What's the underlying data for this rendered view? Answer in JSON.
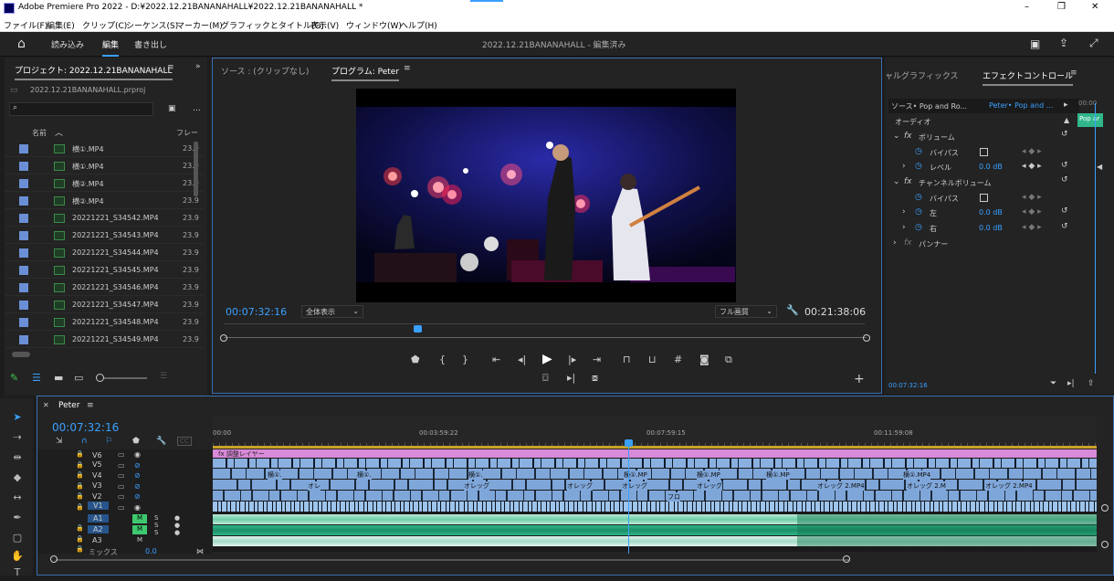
{
  "window": {
    "app": "Adobe Premiere Pro 2022",
    "path": "D:¥2022.12.21BANANAHALL¥2022.12.21BANANAHALL *",
    "controls": [
      "–",
      "❐",
      "✕"
    ]
  },
  "menu": [
    "ファイル(F)",
    "編集(E)",
    "クリップ(C)",
    "シーケンス(S)",
    "マーカー(M)",
    "グラフィックとタイトル(G)",
    "表示(V)",
    "ウィンドウ(W)",
    "ヘルプ(H)"
  ],
  "workspace": {
    "tabs": [
      "読み込み",
      "編集",
      "書き出し"
    ],
    "active": "編集",
    "title": "2022.12.21BANANAHALL - 編集済み"
  },
  "project": {
    "tab": "プロジェクト: 2022.12.21BANANAHALL",
    "file": "2022.12.21BANANAHALL.prproj",
    "col_name": "名前",
    "col_fps": "フレー",
    "items": [
      {
        "name": "横①.MP4",
        "fps": "23.9"
      },
      {
        "name": "横①.MP4",
        "fps": "23.9"
      },
      {
        "name": "横②.MP4",
        "fps": "23.9"
      },
      {
        "name": "横②.MP4",
        "fps": "23.9"
      },
      {
        "name": "20221221_S34542.MP4",
        "fps": "23.9"
      },
      {
        "name": "20221221_S34543.MP4",
        "fps": "23.9"
      },
      {
        "name": "20221221_S34544.MP4",
        "fps": "23.9"
      },
      {
        "name": "20221221_S34545.MP4",
        "fps": "23.9"
      },
      {
        "name": "20221221_S34546.MP4",
        "fps": "23.9"
      },
      {
        "name": "20221221_S34547.MP4",
        "fps": "23.9"
      },
      {
        "name": "20221221_S34548.MP4",
        "fps": "23.9"
      },
      {
        "name": "20221221_S34549.MP4",
        "fps": "23.9"
      }
    ]
  },
  "monitor": {
    "source_tab": "ソース : (クリップなし)",
    "program_tab": "プログラム: Peter",
    "timecode": "00:07:32:16",
    "zoom": "全体表示",
    "quality": "フル画質",
    "duration": "00:21:38:06",
    "playhead": 0.735
  },
  "effects": {
    "tab_left": "ャルグラフィックス",
    "tab": "エフェクトコントロール",
    "source": "ソース• Pop and Ro...",
    "target": "Peter• Pop and ...",
    "clip_label": "Pop ar",
    "time_top": "00:00",
    "section": "オーディオ",
    "volume": "ボリューム",
    "bypass": "バイパス",
    "level": "レベル",
    "level_val": "0.0 dB",
    "channel": "チャンネルボリューム",
    "bypass2": "バイパス",
    "left": "左",
    "left_val": "0.0 dB",
    "right": "右",
    "right_val": "0.0 dB",
    "panner": "パンナー",
    "timecode": "00:07:32:16"
  },
  "timeline": {
    "tab": "Peter",
    "timecode": "00:07:32:16",
    "ruler": [
      "00:00",
      "00:03:59:22",
      "00:07:59:15",
      "00:11:59:08"
    ],
    "adj_layer": "調整レイヤー",
    "tracks": [
      "V6",
      "V5",
      "V4",
      "V3",
      "V2",
      "V1",
      "A1",
      "A2",
      "A3"
    ],
    "mix": "ミックス",
    "mix_val": "0.0",
    "clip_labels": [
      "横①.",
      "横①.",
      "横①.",
      "横①.MP",
      "横①.MP",
      "横①.MP",
      "横①.MP4",
      "オレ",
      "オレッグ",
      "オレッグ",
      "オレッグ",
      "オレッグ",
      "オレッグ 2.MP4",
      "オレッグ 2.M",
      "オレッグ 2.MP4",
      "フロ"
    ]
  },
  "colors": {
    "accent": "#2d8ceb",
    "adj": "#d98ad8",
    "video": "#7fa6d9",
    "audio": "#3fbf8f",
    "timecode": "#3aa0ff"
  }
}
